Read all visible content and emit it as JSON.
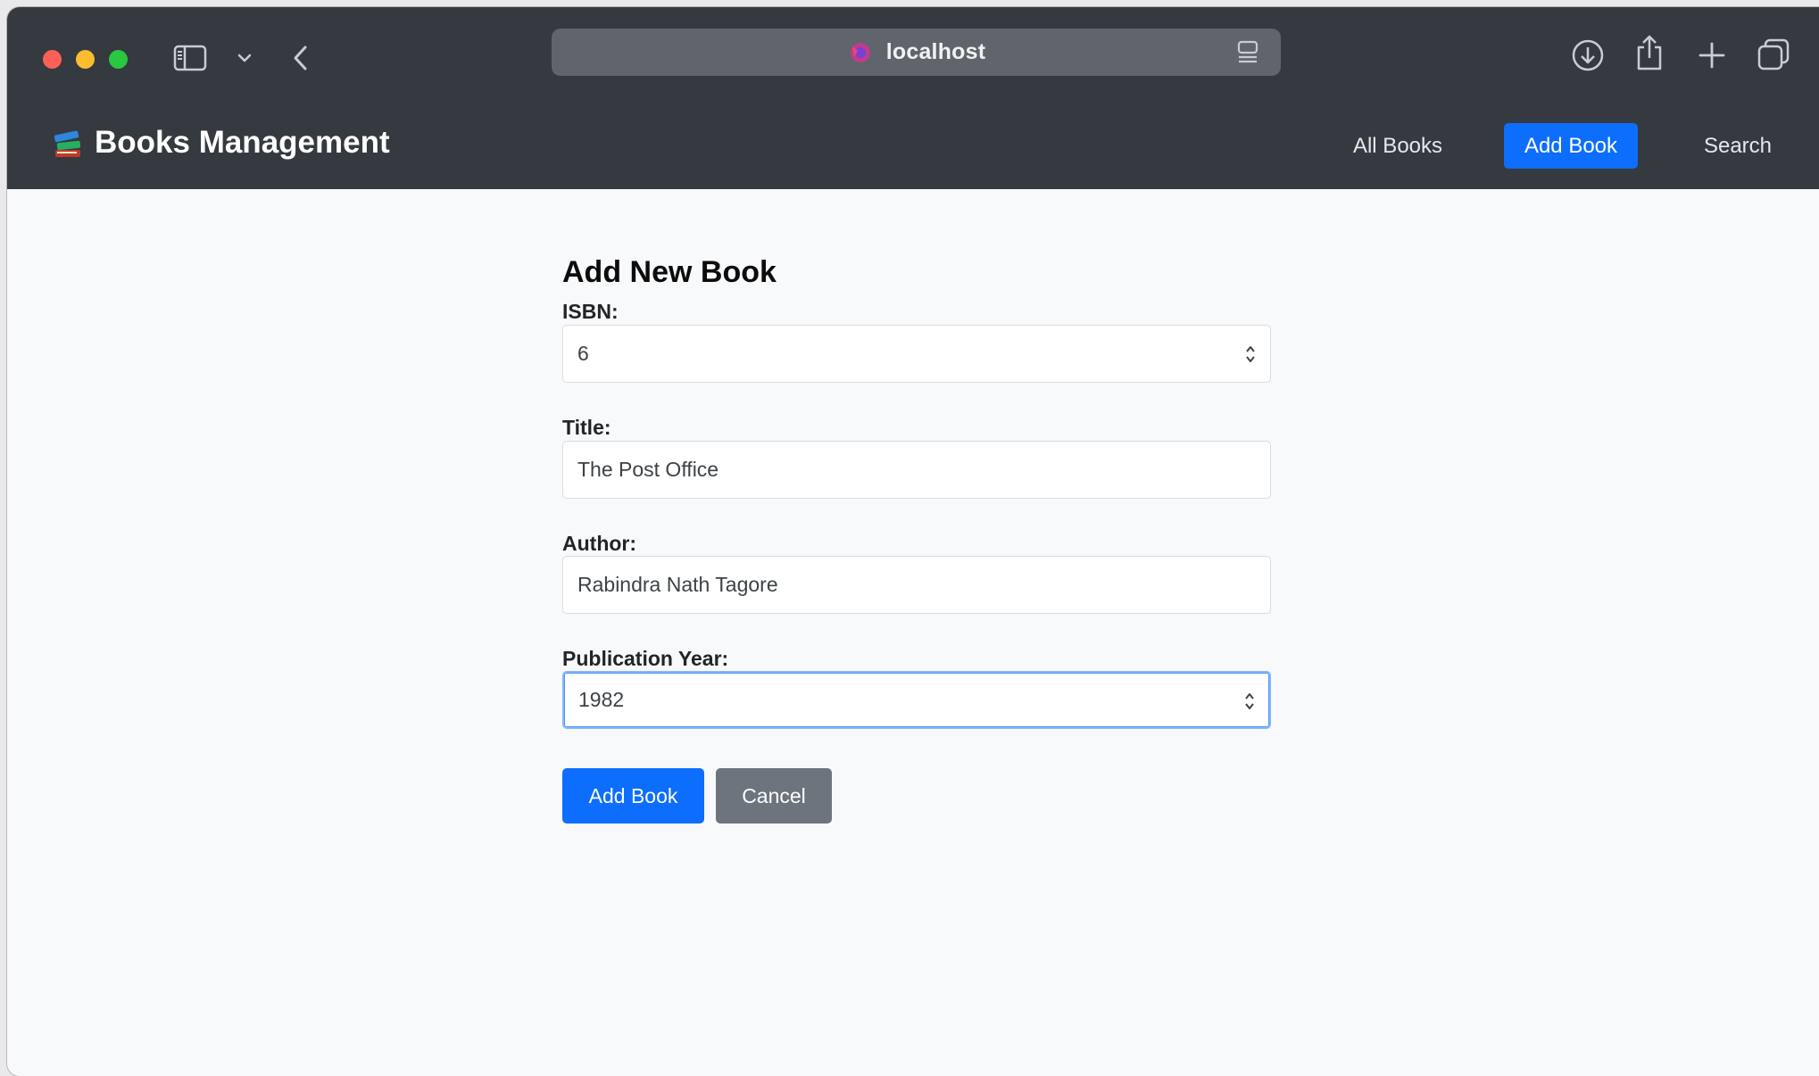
{
  "browser": {
    "address": "localhost"
  },
  "navbar": {
    "brand": "Books Management",
    "links": [
      {
        "label": "All Books",
        "active": false
      },
      {
        "label": "Add Book",
        "active": true
      },
      {
        "label": "Search",
        "active": false
      }
    ]
  },
  "form": {
    "title": "Add New Book",
    "fields": [
      {
        "label": "ISBN:",
        "value": "6",
        "type": "number"
      },
      {
        "label": "Title:",
        "value": "The Post Office",
        "type": "text"
      },
      {
        "label": "Author:",
        "value": "Rabindra Nath Tagore",
        "type": "text"
      },
      {
        "label": "Publication Year:",
        "value": "1982",
        "type": "number",
        "focused": true
      }
    ],
    "submit_label": "Add Book",
    "cancel_label": "Cancel"
  },
  "colors": {
    "navbar_bg": "#343a40",
    "primary": "#0d6efd",
    "secondary": "#6c757d",
    "page_bg": "#f8f9fa"
  }
}
